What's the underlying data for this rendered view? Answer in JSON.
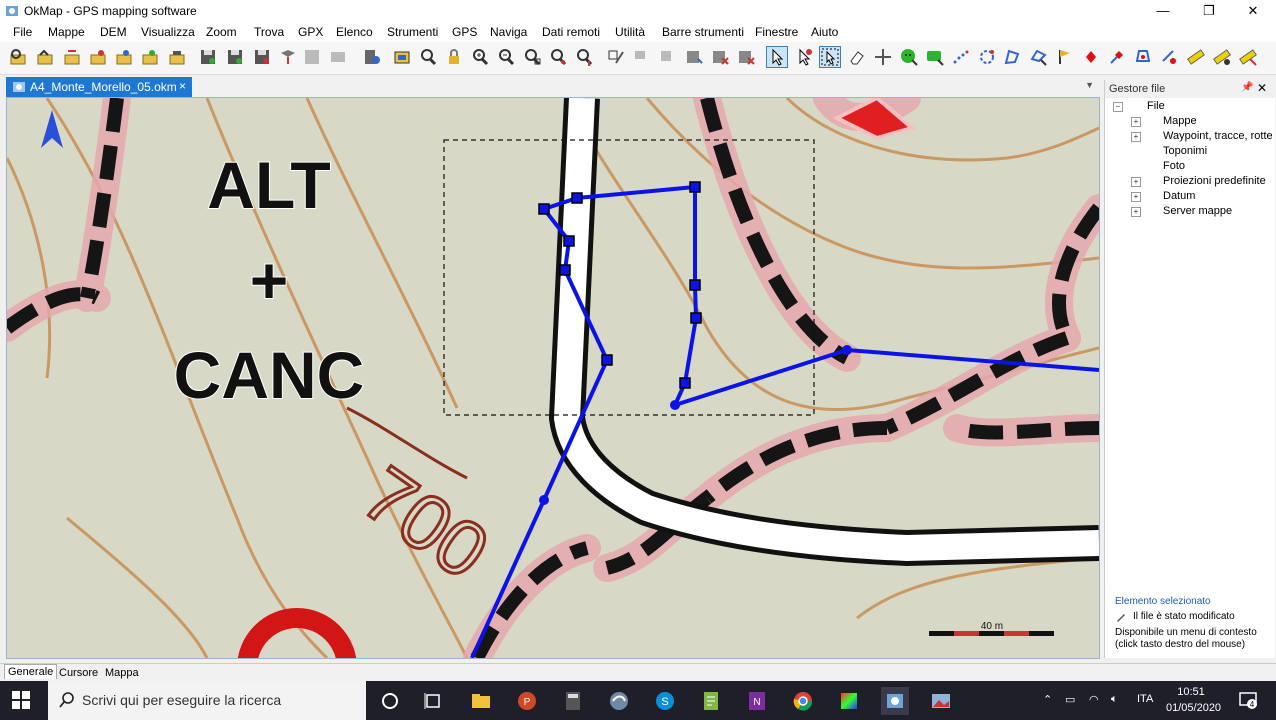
{
  "window": {
    "title": "OkMap - GPS mapping software",
    "controls": {
      "minimize": "—",
      "maximize": "❐",
      "close": "✕"
    }
  },
  "menu": [
    "File",
    "Mappe",
    "DEM",
    "Visualizza",
    "Zoom",
    "Trova",
    "GPX",
    "Elenco",
    "Strumenti",
    "GPS",
    "Naviga",
    "Dati remoti",
    "Utilità",
    "Barre strumenti",
    "Finestre",
    "Aiuto"
  ],
  "document_tab": {
    "label": "A4_Monte_Morello_05.okm",
    "close": "×"
  },
  "map": {
    "overlay_lines": [
      "ALT",
      "+",
      "CANC"
    ],
    "contour_label": "700",
    "scale_label": "40 m",
    "north_arrow": "north-arrow-icon",
    "track_color": "#0a14e6"
  },
  "file_panel": {
    "title": "Gestore file",
    "root": "File",
    "children": [
      "Mappe",
      "Waypoint, tracce, rotte",
      "Toponimi",
      "Foto",
      "Proiezioni predefinite",
      "Datum",
      "Server mappe"
    ],
    "selected_title": "Elemento selezionato",
    "status_lines": [
      "Il file è stato modificato",
      "Disponibile un menu di contesto",
      "(click tasto destro del mouse)"
    ]
  },
  "bottom_tabs": [
    "Generale",
    "Cursore",
    "Mappa"
  ],
  "taskbar": {
    "search_placeholder": "Scrivi qui per eseguire la ricerca",
    "language": "ITA",
    "time": "10:51",
    "date": "01/05/2020",
    "notifications": "4"
  }
}
